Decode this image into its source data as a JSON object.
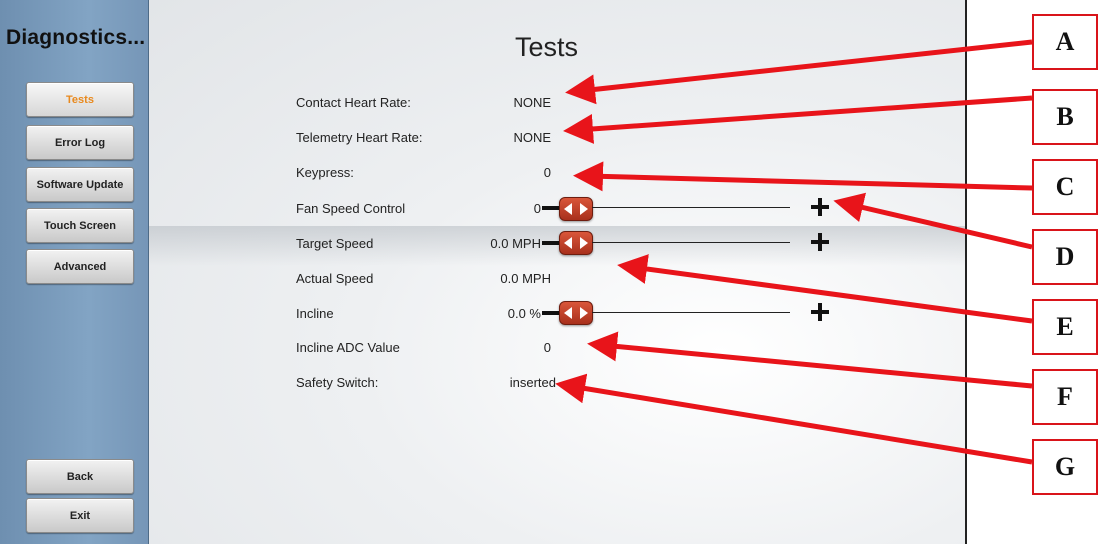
{
  "app_title": "Diagnostics...",
  "sidebar": {
    "items": [
      {
        "label": "Tests",
        "active": true
      },
      {
        "label": "Error Log"
      },
      {
        "label": "Software Update"
      },
      {
        "label": "Touch Screen"
      },
      {
        "label": "Advanced"
      }
    ],
    "bottom": [
      {
        "label": "Back"
      },
      {
        "label": "Exit"
      }
    ]
  },
  "page_title": "Tests",
  "rows": [
    {
      "label": "Contact Heart Rate:",
      "value": "NONE"
    },
    {
      "label": "Telemetry Heart Rate:",
      "value": "NONE"
    },
    {
      "label": "Keypress:",
      "value": "0"
    },
    {
      "label": "Fan Speed Control",
      "value": "0"
    },
    {
      "label": "Target Speed",
      "value": "0.0 MPH"
    },
    {
      "label": "Actual Speed",
      "value": "0.0 MPH"
    },
    {
      "label": "Incline",
      "value": "0.0 %"
    },
    {
      "label": "Incline ADC Value",
      "value": "0"
    },
    {
      "label": "Safety Switch:",
      "value": "inserted"
    }
  ],
  "callouts": [
    "A",
    "B",
    "C",
    "D",
    "E",
    "F",
    "G"
  ],
  "colors": {
    "accent_active": "#e8891e",
    "slider_thumb": "#c0442c",
    "annotation_red": "#e8141a",
    "sidebar_blue": "#7c9dbd"
  },
  "icons": {
    "slider_thumb": "left-right-arrows-icon",
    "slider_plus": "plus-icon"
  }
}
